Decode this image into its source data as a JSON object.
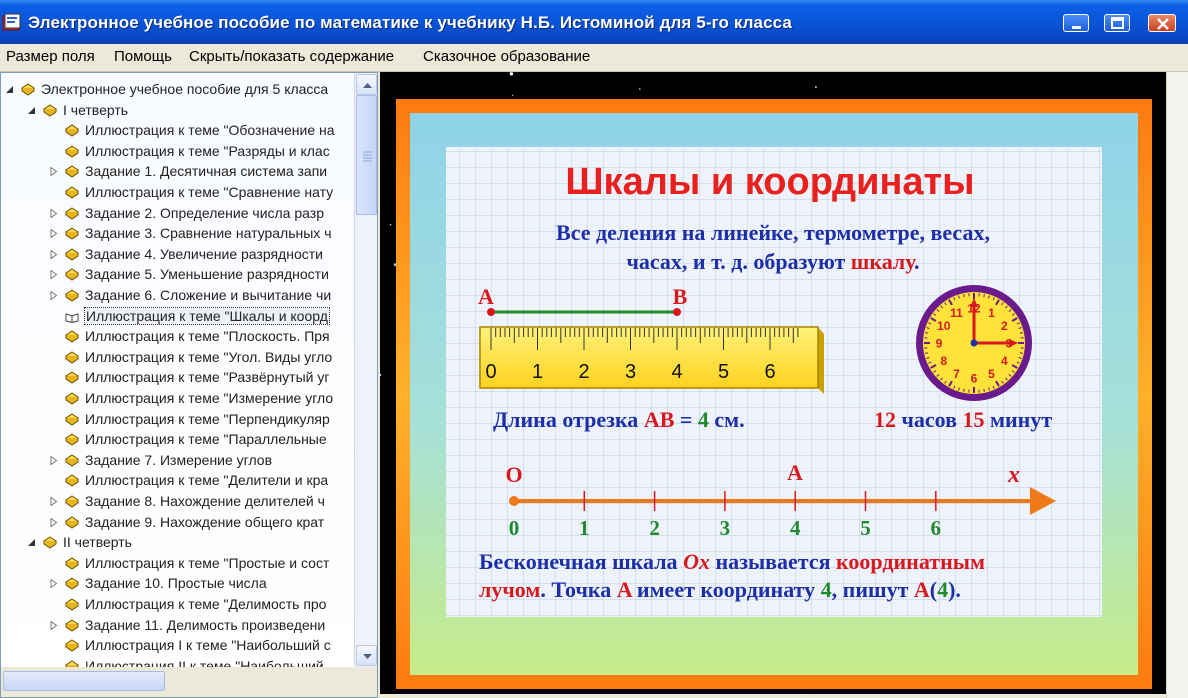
{
  "window": {
    "title": "Электронное учебное пособие по математике к учебнику Н.Б. Истоминой для 5-го класса",
    "app_icon": "book-icon",
    "controls": [
      "minimize-icon",
      "maximize-icon",
      "close-icon"
    ]
  },
  "menu": [
    "Размер поля",
    "Помощь",
    "Скрыть/показать содержание",
    "Сказочное образование"
  ],
  "tree": [
    {
      "level": 0,
      "expander": "collapse",
      "label": "Электронное учебное пособие для 5 класса"
    },
    {
      "level": 1,
      "expander": "collapse",
      "label": "I четверть"
    },
    {
      "level": 2,
      "expander": "none",
      "label": "Иллюстрация к теме \"Обозначение на"
    },
    {
      "level": 2,
      "expander": "none",
      "label": "Иллюстрация к теме \"Разряды и клас"
    },
    {
      "level": 2,
      "expander": "expand",
      "label": "Задание 1. Десятичная система запи"
    },
    {
      "level": 2,
      "expander": "none",
      "label": "Иллюстрация к теме \"Сравнение нату"
    },
    {
      "level": 2,
      "expander": "expand",
      "label": "Задание 2. Определение числа разр"
    },
    {
      "level": 2,
      "expander": "expand",
      "label": "Задание 3. Сравнение натуральных ч"
    },
    {
      "level": 2,
      "expander": "expand",
      "label": "Задание 4. Увеличение разрядности"
    },
    {
      "level": 2,
      "expander": "expand",
      "label": "Задание 5. Уменьшение разрядности"
    },
    {
      "level": 2,
      "expander": "expand",
      "label": "Задание 6. Сложение и вычитание чи"
    },
    {
      "level": 2,
      "expander": "none",
      "label": "Иллюстрация к теме \"Шкалы и коорд",
      "selected": true
    },
    {
      "level": 2,
      "expander": "none",
      "label": "Иллюстрация к теме \"Плоскость. Пря"
    },
    {
      "level": 2,
      "expander": "none",
      "label": "Иллюстрация к теме \"Угол. Виды угло"
    },
    {
      "level": 2,
      "expander": "none",
      "label": "Иллюстрация к теме \"Развёрнутый уг"
    },
    {
      "level": 2,
      "expander": "none",
      "label": "Иллюстрация к теме \"Измерение угло"
    },
    {
      "level": 2,
      "expander": "none",
      "label": "Иллюстрация к теме \"Перпендикуляр"
    },
    {
      "level": 2,
      "expander": "none",
      "label": "Иллюстрация к теме \"Параллельные"
    },
    {
      "level": 2,
      "expander": "expand",
      "label": "Задание 7. Измерение углов"
    },
    {
      "level": 2,
      "expander": "none",
      "label": "Иллюстрация к теме \"Делители и кра"
    },
    {
      "level": 2,
      "expander": "expand",
      "label": "Задание 8. Нахождение делителей ч"
    },
    {
      "level": 2,
      "expander": "expand",
      "label": "Задание 9. Нахождение общего крат"
    },
    {
      "level": 1,
      "expander": "collapse",
      "label": "II четверть"
    },
    {
      "level": 2,
      "expander": "none",
      "label": "Иллюстрация к теме \"Простые и сост"
    },
    {
      "level": 2,
      "expander": "expand",
      "label": "Задание 10. Простые числа"
    },
    {
      "level": 2,
      "expander": "none",
      "label": "Иллюстрация к теме \"Делимость про"
    },
    {
      "level": 2,
      "expander": "expand",
      "label": "Задание 11. Делимость произведени"
    },
    {
      "level": 2,
      "expander": "none",
      "label": "Иллюстрация I к теме \"Наибольший с"
    },
    {
      "level": 2,
      "expander": "none",
      "label": "Иллюстрация II к теме \"Наибольший"
    }
  ],
  "slide": {
    "title": "Шкалы и координаты",
    "intro_line1": "Все деления на линейке, термометре, весах,",
    "intro_line2_a": "часах, и т. д. образуют ",
    "intro_line2_b": "шкалу",
    "intro_line2_c": ".",
    "segment_label_a": "A",
    "segment_label_b": "B",
    "ruler_numbers": [
      "0",
      "1",
      "2",
      "3",
      "4",
      "5",
      "6"
    ],
    "clock_numbers": [
      "12",
      "1",
      "2",
      "3",
      "4",
      "5",
      "6",
      "7",
      "8",
      "9",
      "10",
      "11"
    ],
    "length_text_a": "Длина отрезка ",
    "length_text_b": "AB",
    "length_text_c": " = ",
    "length_text_d": "4",
    "length_text_e": " см.",
    "time_text_a": "12",
    "time_text_b": " часов ",
    "time_text_c": "15",
    "time_text_d": " минут",
    "ray_origin_label": "O",
    "ray_point_label": "A",
    "ray_axis_label": "x",
    "ray_numbers": [
      "0",
      "1",
      "2",
      "3",
      "4",
      "5",
      "6"
    ],
    "bottom_1a": "Бесконечная шкала ",
    "bottom_1b": "Ox",
    "bottom_1c": " называется ",
    "bottom_1d": "координатным",
    "bottom_2a": "лучом",
    "bottom_2b": ". Точка ",
    "bottom_2c": "A",
    "bottom_2d": " имеет координату ",
    "bottom_2e": "4",
    "bottom_2f": ", пишут ",
    "bottom_2g": "A",
    "bottom_2h": "(",
    "bottom_2i": "4",
    "bottom_2j": ")."
  },
  "colors": {
    "title_red": "#e8201e",
    "text_blue": "#1c2fa8",
    "accent_red": "#d9181e",
    "accent_green": "#1e8a2a",
    "ray_orange": "#f07a1a",
    "ruler_yellow": "#ffe23a",
    "frame_orange": "#f28a10"
  }
}
